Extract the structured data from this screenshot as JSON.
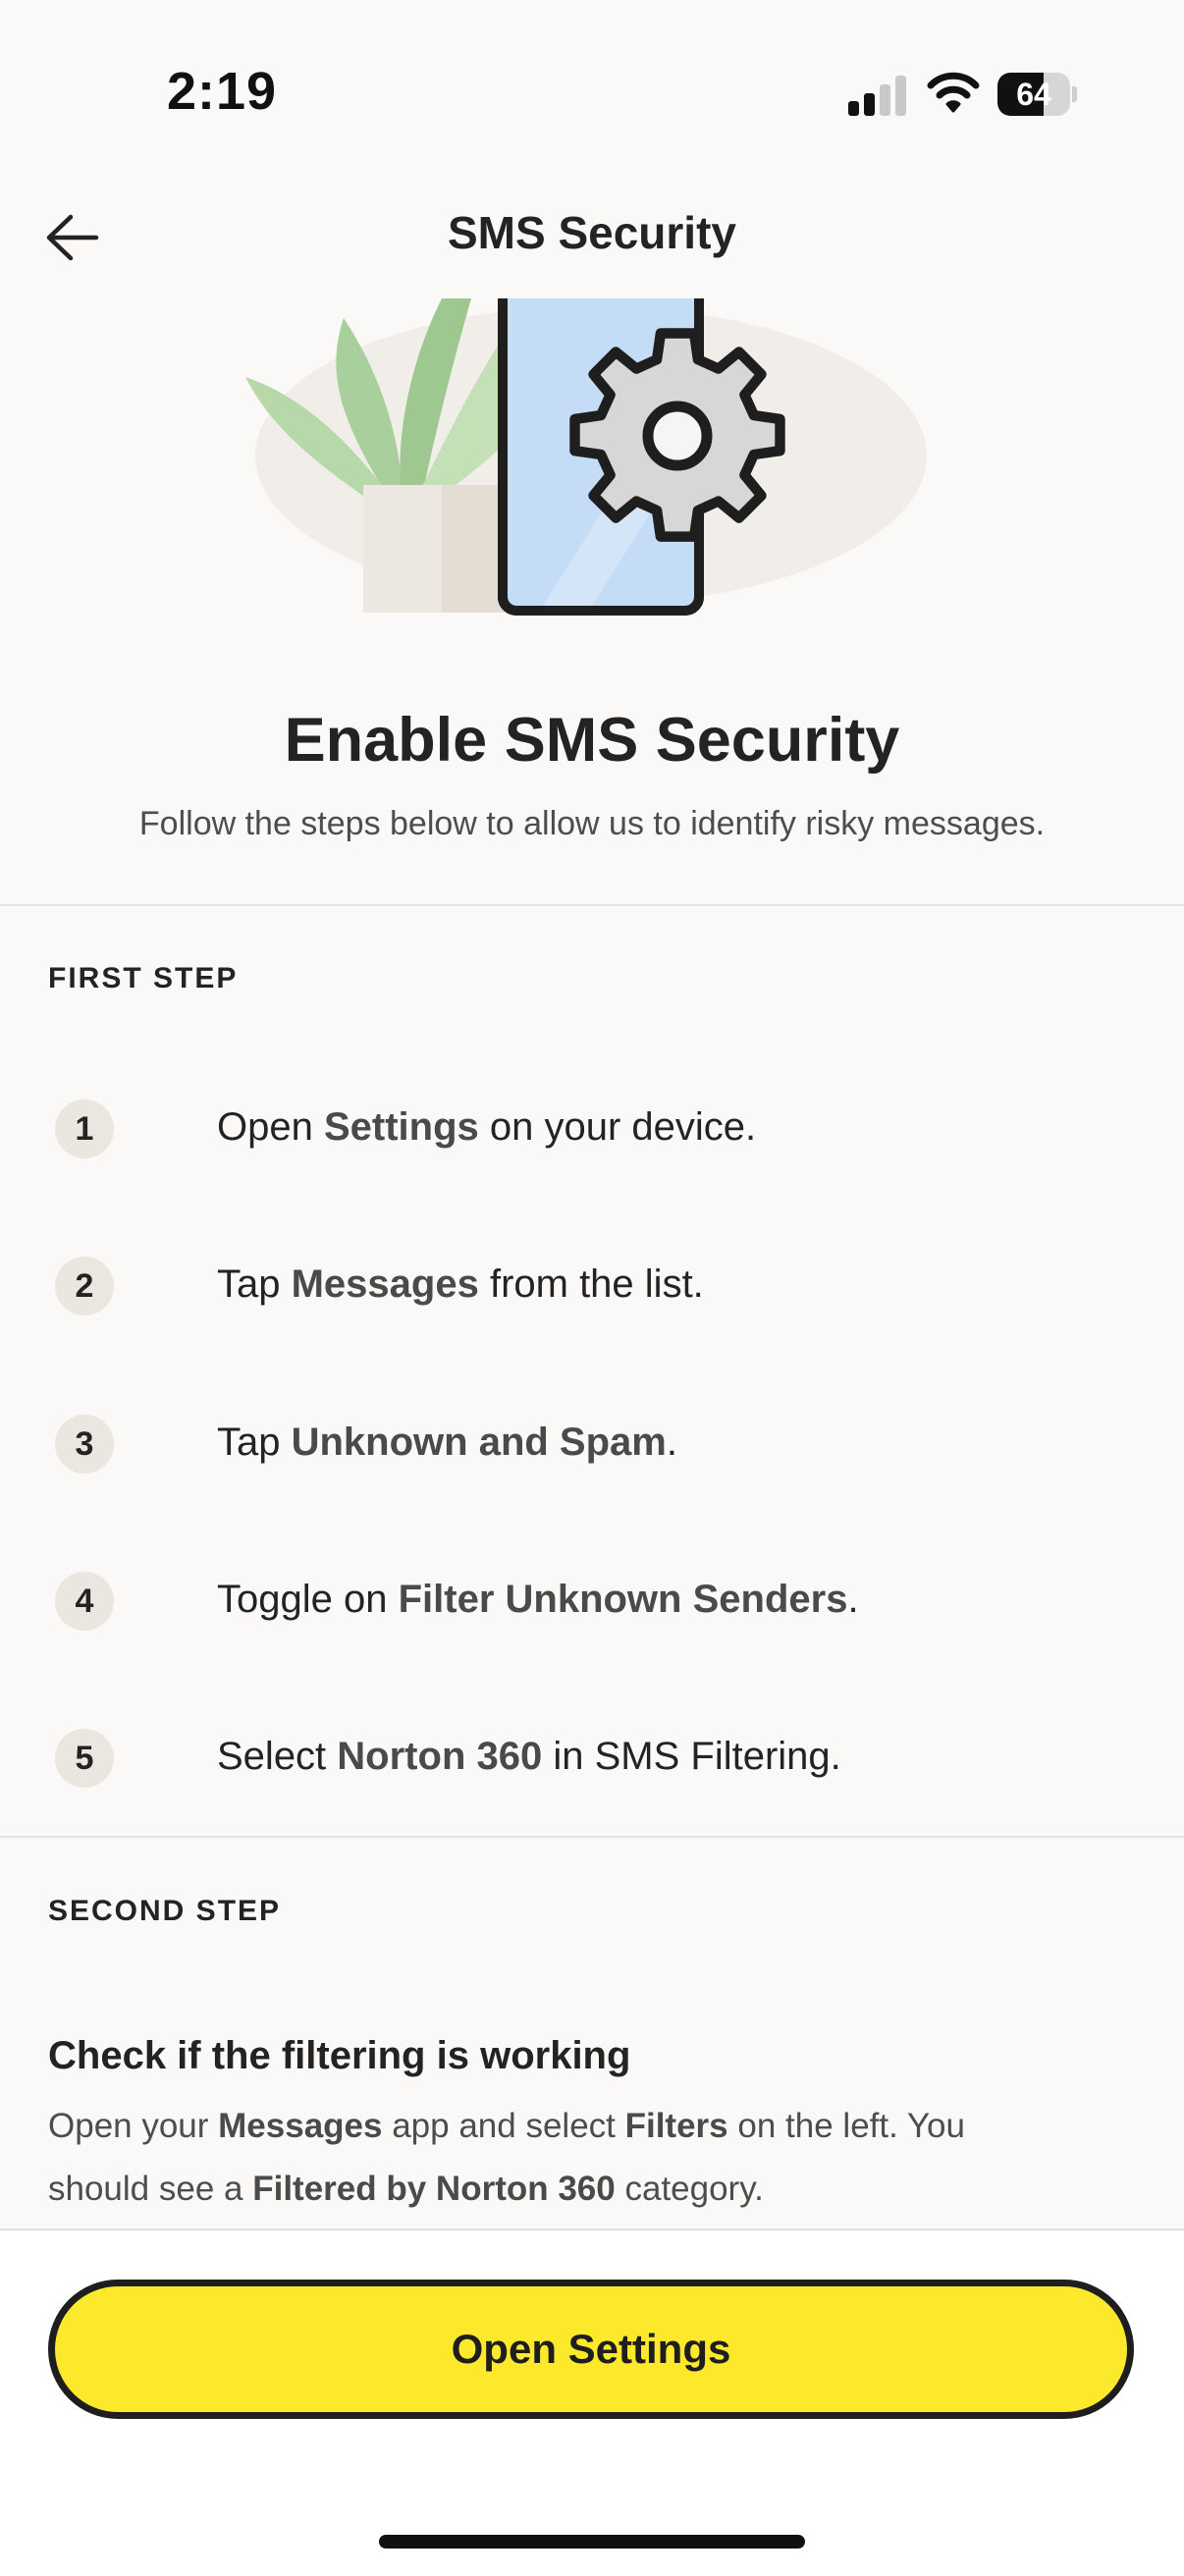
{
  "status_bar": {
    "time": "2:19",
    "battery_level": 64,
    "battery_text": "64",
    "signal_bars": 2,
    "signal_bars_total": 4
  },
  "header": {
    "title": "SMS Security",
    "back_icon": "arrow-left-icon"
  },
  "hero": {
    "illustration": "phone-with-gear-and-plant"
  },
  "intro": {
    "heading": "Enable SMS Security",
    "subheading": "Follow the steps below to allow us to identify risky messages."
  },
  "first_step": {
    "label": "FIRST STEP",
    "steps": [
      {
        "number": "1",
        "pre": "Open ",
        "bold": "Settings",
        "post": " on your device."
      },
      {
        "number": "2",
        "pre": "Tap ",
        "bold": "Messages",
        "post": " from the list."
      },
      {
        "number": "3",
        "pre": "Tap ",
        "bold": "Unknown and Spam",
        "post": "."
      },
      {
        "number": "4",
        "pre": "Toggle on ",
        "bold": "Filter Unknown Senders",
        "post": "."
      },
      {
        "number": "5",
        "pre": "Select ",
        "bold": "Norton 360",
        "post": " in SMS Filtering."
      }
    ]
  },
  "second_step": {
    "label": "SECOND STEP",
    "title": "Check if the filtering is working",
    "line1": {
      "t1": "Open your ",
      "b1": "Messages",
      "t2": " app and select ",
      "b2": "Filters",
      "t3": " on the left. You"
    },
    "line2": {
      "t1": "should see a ",
      "b1": "Filtered by Norton 360",
      "t2": " category."
    }
  },
  "footer": {
    "button_label": "Open Settings"
  },
  "colors": {
    "background": "#faf9f7",
    "accent_yellow": "#fde92b",
    "text_dark": "#232323",
    "step_badge": "#ebe6e0"
  }
}
